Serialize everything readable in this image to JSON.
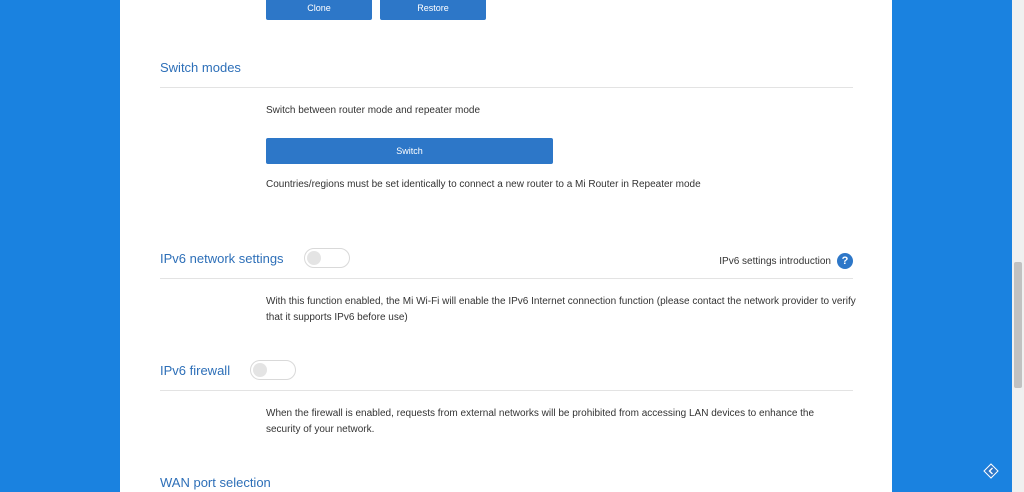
{
  "mac_clone": {
    "clone_label": "Clone",
    "restore_label": "Restore"
  },
  "switch_modes": {
    "title": "Switch modes",
    "description": "Switch between router mode and repeater mode",
    "switch_label": "Switch",
    "note": "Countries/regions must be set identically to connect a new router to a Mi Router in Repeater mode"
  },
  "ipv6_settings": {
    "title": "IPv6 network settings",
    "enabled": false,
    "help_label": "IPv6 settings introduction",
    "help_glyph": "?",
    "description": "With this function enabled, the Mi Wi-Fi will enable the IPv6 Internet connection function (please contact the network provider to verify that it supports IPv6 before use)"
  },
  "ipv6_firewall": {
    "title": "IPv6 firewall",
    "enabled": false,
    "description": "When the firewall is enabled, requests from external networks will be prohibited from accessing LAN devices to enhance the security of your network."
  },
  "wan_port": {
    "title": "WAN port selection"
  },
  "colors": {
    "accent": "#2d77c8",
    "title": "#2d6fb8",
    "background": "#1a82e0"
  },
  "icons": {
    "help": "question-circle-icon",
    "corner": "diamond-arrow-icon"
  }
}
